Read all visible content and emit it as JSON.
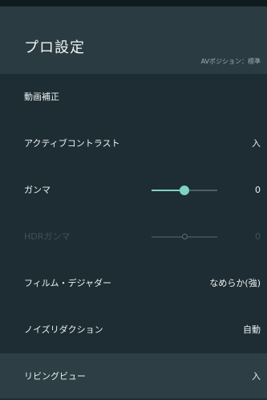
{
  "header": {
    "title": "プロ設定",
    "subtitle": "AVポジション：標準"
  },
  "items": [
    {
      "label": "動画補正",
      "value": ""
    },
    {
      "label": "アクティブコントラスト",
      "value": "入"
    },
    {
      "label": "ガンマ",
      "value": "0",
      "slider_level": 0.5
    },
    {
      "label": "HDRガンマ",
      "value": "0",
      "slider_level": 0.5,
      "disabled": true
    },
    {
      "label": "フィルム・デジャダー",
      "value": "なめらか(強)"
    },
    {
      "label": "ノイズリダクション",
      "value": "自動"
    },
    {
      "label": "リビングビュー",
      "value": "入"
    }
  ],
  "colors": {
    "accent": "#7fd3c6",
    "background": "#1e2d33",
    "header_background": "#2a3b41"
  }
}
